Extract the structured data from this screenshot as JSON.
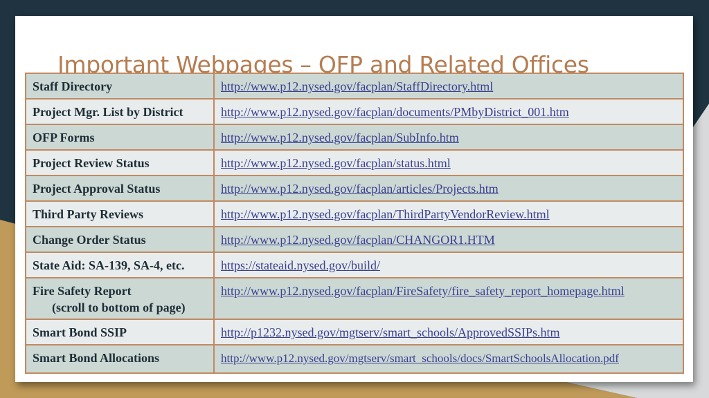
{
  "slide": {
    "title": "Important Webpages – OFP and Related Offices",
    "colors": {
      "title": "#b57d52",
      "link": "#3a3f8f",
      "row_dark": "#ccd8d4",
      "row_light": "#e8ecec",
      "border": "#c08a62",
      "background_navy": "#1f3440",
      "background_gold": "#c09a58"
    }
  },
  "table": {
    "rows": [
      {
        "label": "Staff Directory",
        "url": "http://www.p12.nysed.gov/facplan/StaffDirectory.html"
      },
      {
        "label": "Project Mgr. List by District",
        "url": "http://www.p12.nysed.gov/facplan/documents/PMbyDistrict_001.htm"
      },
      {
        "label": "OFP Forms",
        "url": "http://www.p12.nysed.gov/facplan/SubInfo.htm"
      },
      {
        "label": "Project Review Status",
        "url": "http://www.p12.nysed.gov/facplan/status.html"
      },
      {
        "label": "Project Approval Status",
        "url": "http://www.p12.nysed.gov/facplan/articles/Projects.htm"
      },
      {
        "label": "Third Party Reviews",
        "url": "http://www.p12.nysed.gov/facplan/ThirdPartyVendorReview.html"
      },
      {
        "label": "Change Order Status",
        "url": "http://www.p12.nysed.gov/facplan/CHANGOR1.HTM"
      },
      {
        "label": "State Aid: SA-139, SA-4, etc.",
        "url": "https://stateaid.nysed.gov/build/"
      },
      {
        "label": "Fire Safety Report",
        "sublabel": "(scroll to bottom of page)",
        "url": "http://www.p12.nysed.gov/facplan/FireSafety/fire_safety_report_homepage.html"
      },
      {
        "label": "Smart Bond SSIP",
        "url": "http://p1232.nysed.gov/mgtserv/smart_schools/ApprovedSSIPs.htm"
      },
      {
        "label": "Smart Bond Allocations",
        "url": "http://www.p12.nysed.gov/mgtserv/smart_schools/docs/SmartSchoolsAllocation.pdf"
      }
    ]
  }
}
